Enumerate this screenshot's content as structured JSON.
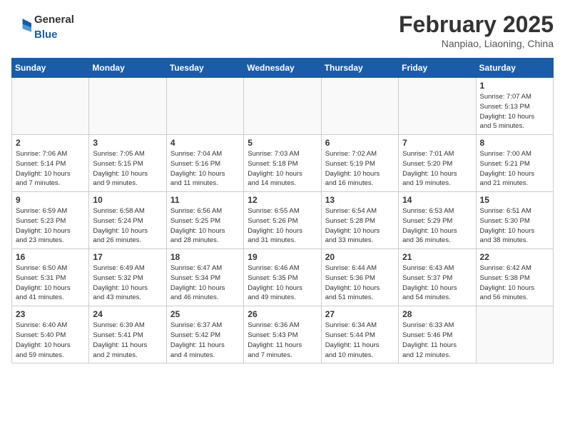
{
  "header": {
    "logo": {
      "general": "General",
      "blue": "Blue"
    },
    "month": "February 2025",
    "location": "Nanpiao, Liaoning, China"
  },
  "weekdays": [
    "Sunday",
    "Monday",
    "Tuesday",
    "Wednesday",
    "Thursday",
    "Friday",
    "Saturday"
  ],
  "weeks": [
    [
      {
        "day": "",
        "info": ""
      },
      {
        "day": "",
        "info": ""
      },
      {
        "day": "",
        "info": ""
      },
      {
        "day": "",
        "info": ""
      },
      {
        "day": "",
        "info": ""
      },
      {
        "day": "",
        "info": ""
      },
      {
        "day": "1",
        "info": "Sunrise: 7:07 AM\nSunset: 5:13 PM\nDaylight: 10 hours\nand 5 minutes."
      }
    ],
    [
      {
        "day": "2",
        "info": "Sunrise: 7:06 AM\nSunset: 5:14 PM\nDaylight: 10 hours\nand 7 minutes."
      },
      {
        "day": "3",
        "info": "Sunrise: 7:05 AM\nSunset: 5:15 PM\nDaylight: 10 hours\nand 9 minutes."
      },
      {
        "day": "4",
        "info": "Sunrise: 7:04 AM\nSunset: 5:16 PM\nDaylight: 10 hours\nand 11 minutes."
      },
      {
        "day": "5",
        "info": "Sunrise: 7:03 AM\nSunset: 5:18 PM\nDaylight: 10 hours\nand 14 minutes."
      },
      {
        "day": "6",
        "info": "Sunrise: 7:02 AM\nSunset: 5:19 PM\nDaylight: 10 hours\nand 16 minutes."
      },
      {
        "day": "7",
        "info": "Sunrise: 7:01 AM\nSunset: 5:20 PM\nDaylight: 10 hours\nand 19 minutes."
      },
      {
        "day": "8",
        "info": "Sunrise: 7:00 AM\nSunset: 5:21 PM\nDaylight: 10 hours\nand 21 minutes."
      }
    ],
    [
      {
        "day": "9",
        "info": "Sunrise: 6:59 AM\nSunset: 5:23 PM\nDaylight: 10 hours\nand 23 minutes."
      },
      {
        "day": "10",
        "info": "Sunrise: 6:58 AM\nSunset: 5:24 PM\nDaylight: 10 hours\nand 26 minutes."
      },
      {
        "day": "11",
        "info": "Sunrise: 6:56 AM\nSunset: 5:25 PM\nDaylight: 10 hours\nand 28 minutes."
      },
      {
        "day": "12",
        "info": "Sunrise: 6:55 AM\nSunset: 5:26 PM\nDaylight: 10 hours\nand 31 minutes."
      },
      {
        "day": "13",
        "info": "Sunrise: 6:54 AM\nSunset: 5:28 PM\nDaylight: 10 hours\nand 33 minutes."
      },
      {
        "day": "14",
        "info": "Sunrise: 6:53 AM\nSunset: 5:29 PM\nDaylight: 10 hours\nand 36 minutes."
      },
      {
        "day": "15",
        "info": "Sunrise: 6:51 AM\nSunset: 5:30 PM\nDaylight: 10 hours\nand 38 minutes."
      }
    ],
    [
      {
        "day": "16",
        "info": "Sunrise: 6:50 AM\nSunset: 5:31 PM\nDaylight: 10 hours\nand 41 minutes."
      },
      {
        "day": "17",
        "info": "Sunrise: 6:49 AM\nSunset: 5:32 PM\nDaylight: 10 hours\nand 43 minutes."
      },
      {
        "day": "18",
        "info": "Sunrise: 6:47 AM\nSunset: 5:34 PM\nDaylight: 10 hours\nand 46 minutes."
      },
      {
        "day": "19",
        "info": "Sunrise: 6:46 AM\nSunset: 5:35 PM\nDaylight: 10 hours\nand 49 minutes."
      },
      {
        "day": "20",
        "info": "Sunrise: 6:44 AM\nSunset: 5:36 PM\nDaylight: 10 hours\nand 51 minutes."
      },
      {
        "day": "21",
        "info": "Sunrise: 6:43 AM\nSunset: 5:37 PM\nDaylight: 10 hours\nand 54 minutes."
      },
      {
        "day": "22",
        "info": "Sunrise: 6:42 AM\nSunset: 5:38 PM\nDaylight: 10 hours\nand 56 minutes."
      }
    ],
    [
      {
        "day": "23",
        "info": "Sunrise: 6:40 AM\nSunset: 5:40 PM\nDaylight: 10 hours\nand 59 minutes."
      },
      {
        "day": "24",
        "info": "Sunrise: 6:39 AM\nSunset: 5:41 PM\nDaylight: 11 hours\nand 2 minutes."
      },
      {
        "day": "25",
        "info": "Sunrise: 6:37 AM\nSunset: 5:42 PM\nDaylight: 11 hours\nand 4 minutes."
      },
      {
        "day": "26",
        "info": "Sunrise: 6:36 AM\nSunset: 5:43 PM\nDaylight: 11 hours\nand 7 minutes."
      },
      {
        "day": "27",
        "info": "Sunrise: 6:34 AM\nSunset: 5:44 PM\nDaylight: 11 hours\nand 10 minutes."
      },
      {
        "day": "28",
        "info": "Sunrise: 6:33 AM\nSunset: 5:46 PM\nDaylight: 11 hours\nand 12 minutes."
      },
      {
        "day": "",
        "info": ""
      }
    ]
  ]
}
